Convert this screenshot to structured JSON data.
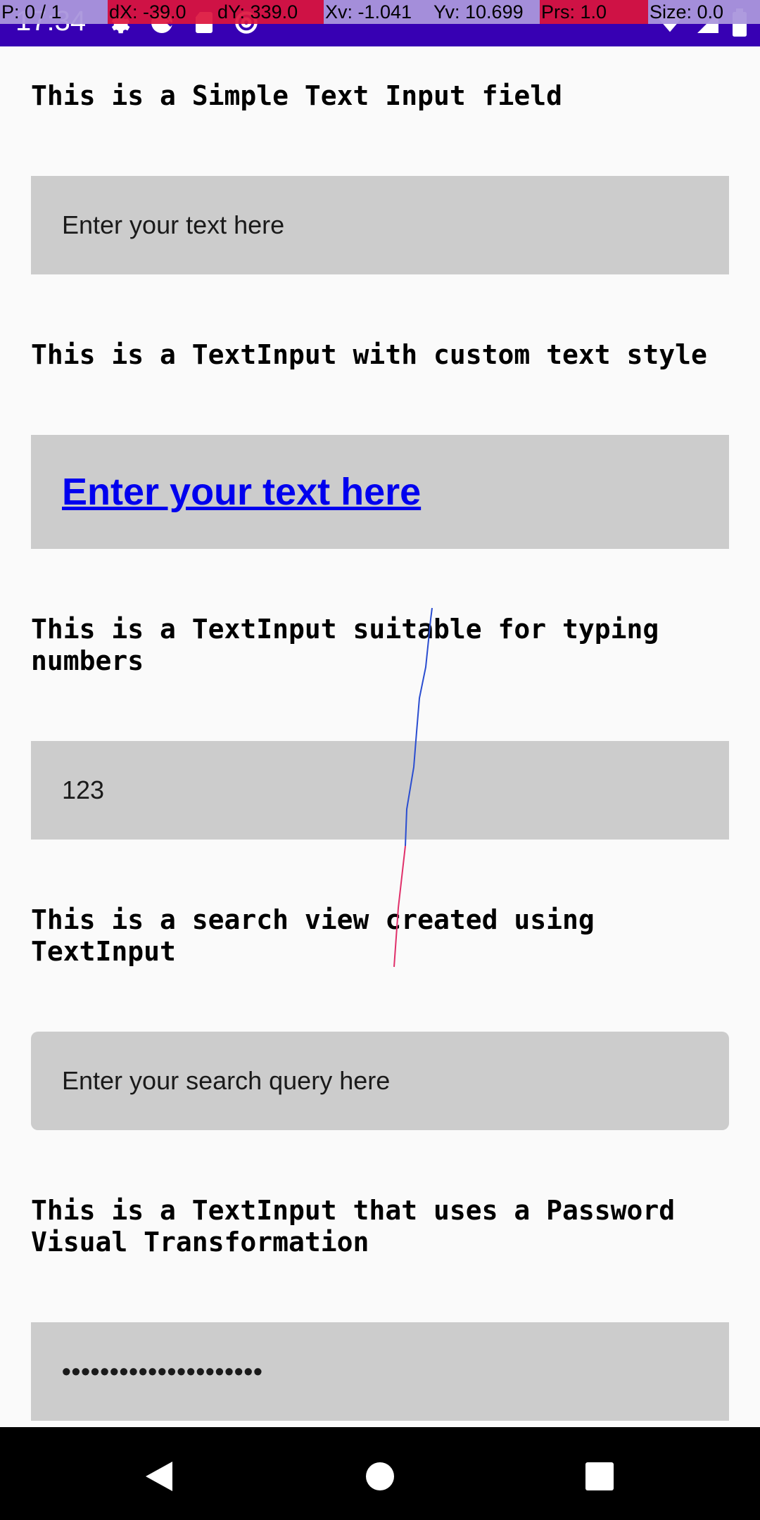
{
  "status_bar": {
    "time": "17:34",
    "color": "#3700b3",
    "left_icons": [
      "settings-gear-icon",
      "sync-icon",
      "sd-card-icon",
      "at-sign-icon"
    ],
    "right_icons": [
      "wifi-icon",
      "signal-icon",
      "battery-icon"
    ]
  },
  "pointer_overlay": {
    "p": "P: 0 / 1",
    "dx": "dX: -39.0",
    "dy": "dY: 339.0",
    "xv": "Xv: -1.041",
    "yv": "Yv: 10.699",
    "prs": "Prs: 1.0",
    "size": "Size: 0.0"
  },
  "sections": {
    "simple": {
      "label": "This is a Simple Text Input field",
      "placeholder": "Enter your text here"
    },
    "custom_style": {
      "label": "This is a TextInput with custom text style",
      "placeholder": "Enter your text here"
    },
    "numbers": {
      "label": "This is a TextInput suitable for typing numbers",
      "value": "123"
    },
    "search": {
      "label": "This is a search view created using TextInput",
      "placeholder": "Enter your search query here"
    },
    "password": {
      "label": "This is a TextInput that uses a Password Visual Transformation",
      "value": "•••••••••••••••••••••"
    }
  },
  "nav_bar": {
    "buttons": [
      "back-icon",
      "home-icon",
      "recents-icon"
    ]
  },
  "colors": {
    "field_background": "#cccccc",
    "page_background": "#fafafa",
    "link_text": "#0000ee"
  }
}
